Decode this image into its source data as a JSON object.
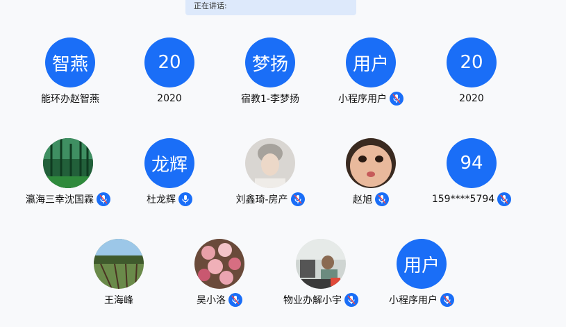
{
  "speaking_label": "正在讲话:",
  "rows": [
    [
      {
        "avatar_text": "智燕",
        "name": "能环办赵智燕",
        "mic": false
      },
      {
        "avatar_text": "20",
        "name": "2020",
        "mic": false
      },
      {
        "avatar_text": "梦扬",
        "name": "宿教1-李梦扬",
        "mic": false
      },
      {
        "avatar_text": "用户",
        "name": "小程序用户",
        "mic": true,
        "mic_muted": true
      },
      {
        "avatar_text": "20",
        "name": "2020",
        "mic": false
      }
    ],
    [
      {
        "avatar_photo": "forest-photo",
        "name": "瀛海三幸沈国霖",
        "mic": true,
        "mic_muted": true
      },
      {
        "avatar_text": "龙辉",
        "name": "杜龙辉",
        "mic": true,
        "mic_muted": false
      },
      {
        "avatar_photo": "woman-portrait-photo",
        "name": "刘鑫琦-房产",
        "mic": true,
        "mic_muted": true
      },
      {
        "avatar_photo": "child-portrait-photo",
        "name": "赵旭",
        "mic": true,
        "mic_muted": true
      },
      {
        "avatar_text": "94",
        "name": "159****5794",
        "mic": true,
        "mic_muted": true
      }
    ],
    [
      {
        "avatar_photo": "garden-landscape-photo",
        "name": "王海峰",
        "mic": false
      },
      {
        "avatar_photo": "roses-bouquet-photo",
        "name": "吴小洛",
        "mic": true,
        "mic_muted": true
      },
      {
        "avatar_photo": "office-desk-photo",
        "name": "物业办解小宇",
        "mic": true,
        "mic_muted": true
      },
      {
        "avatar_text": "用户",
        "name": "小程序用户",
        "mic": true,
        "mic_muted": true
      }
    ]
  ],
  "colors": {
    "accent": "#1a6ef7",
    "banner": "#dde9fb",
    "background": "#f8f9fb"
  }
}
